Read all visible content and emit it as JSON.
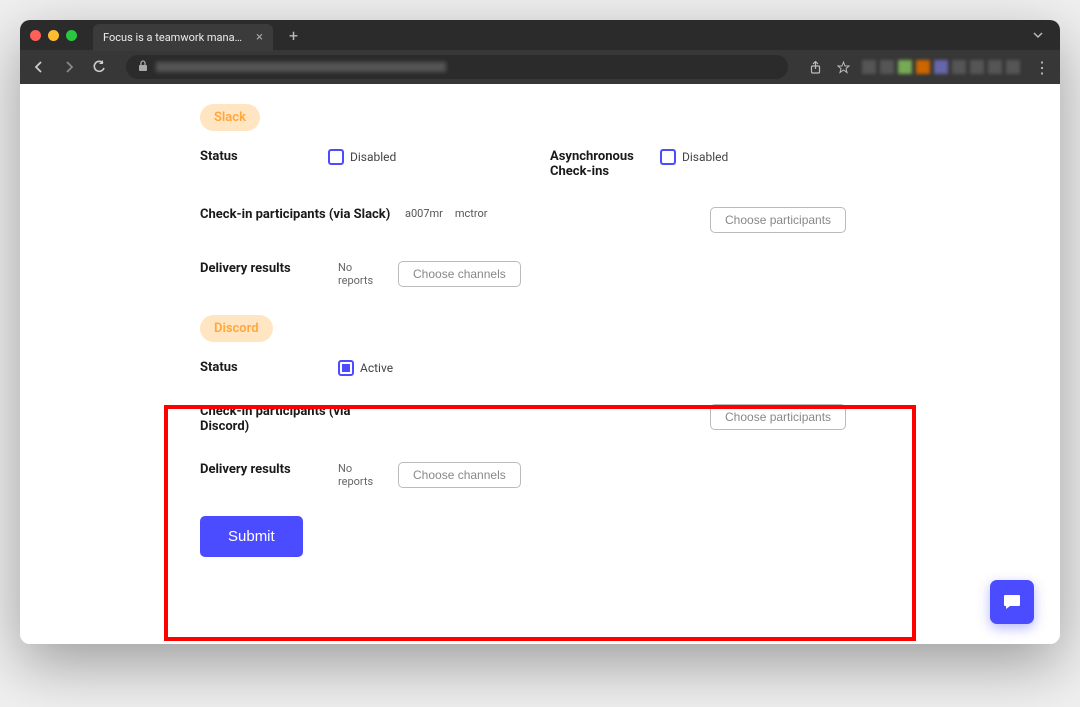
{
  "browser": {
    "tab_title": "Focus is a teamwork managem"
  },
  "slack": {
    "pill": "Slack",
    "status_label": "Status",
    "status_value": "Disabled",
    "async_label": "Asynchronous Check-ins",
    "async_value": "Disabled",
    "participants_label": "Check-in participants (via Slack)",
    "participant1": "a007mr",
    "participant2": "mctror",
    "choose_participants": "Choose participants",
    "delivery_label": "Delivery results",
    "delivery_value": "No reports",
    "choose_channels": "Choose channels"
  },
  "discord": {
    "pill": "Discord",
    "status_label": "Status",
    "status_value": "Active",
    "participants_label": "Check-in participants (via Discord)",
    "choose_participants": "Choose participants",
    "delivery_label": "Delivery results",
    "delivery_value": "No reports",
    "choose_channels": "Choose channels"
  },
  "submit": "Submit"
}
